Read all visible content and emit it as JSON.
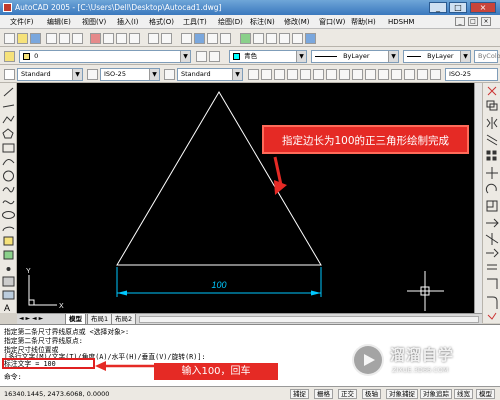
{
  "window": {
    "title": "AutoCAD 2005 - [C:\\Users\\Dell\\Desktop\\Autocad1.dwg]",
    "min": "_",
    "max": "□",
    "close": "×"
  },
  "menu": [
    "文件(F)",
    "编辑(E)",
    "视图(V)",
    "插入(I)",
    "格式(O)",
    "工具(T)",
    "绘图(D)",
    "标注(N)",
    "修改(M)",
    "窗口(W)",
    "帮助(H)",
    "HDSHM"
  ],
  "doc_controls": [
    "_",
    "□",
    "×"
  ],
  "layers": {
    "layer_value": "0",
    "color_value": "青色",
    "color_hex": "#00ffff",
    "linetype_value": "ByLayer",
    "lineweight_value": "ByLayer",
    "plotstyle_value": "ByColor"
  },
  "styles": {
    "text_style": "Standard",
    "dim_style": "ISO-25",
    "table_style": "Standard",
    "dim_style_right": "ISO-25"
  },
  "canvas": {
    "dimension_text": "100",
    "triangle_color": "#ffffff",
    "dim_color": "#00c8ff",
    "ucs_x": "X",
    "ucs_y": "Y",
    "background": "#000000"
  },
  "tabs": [
    "模型",
    "布局1",
    "布局2"
  ],
  "command_lines": [
    "指定第二条尺寸界线原点或 <选择对象>:",
    "指定第二条尺寸界线原点:",
    "指定尺寸线位置或",
    "[多行文字(M)/文字(T)/角度(A)/水平(H)/垂直(V)/旋转(R)]:",
    "标注文字 = 100",
    "命令:"
  ],
  "status": {
    "coords": "16340.1445, 2473.6068, 0.0000",
    "buttons": [
      "捕捉",
      "栅格",
      "正交",
      "极轴",
      "对象捕捉",
      "对象追踪",
      "线宽",
      "模型"
    ]
  },
  "annotations": {
    "top_callout": "指定边长为100的正三角形绘制完成",
    "bottom_callout": "输入100，回车",
    "accent_red": "#e52a25"
  },
  "watermark": {
    "title": "溜溜自学",
    "url": "ZIXUE.3D66.COM"
  }
}
